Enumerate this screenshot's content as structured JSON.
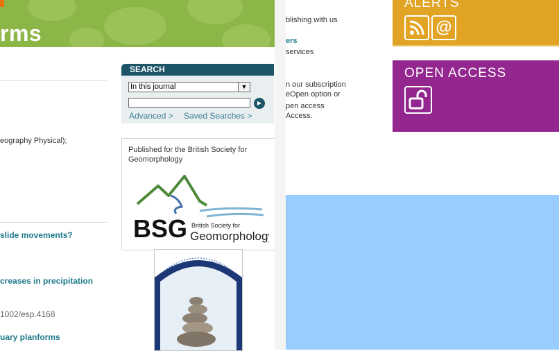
{
  "banner": {
    "title": "rms"
  },
  "left": {
    "subject_text": "eography Physical);",
    "article1_title": "slide movements?",
    "article2_title": "creases in precipitation",
    "doi": "1002/esp.4168",
    "article3_title": "uary planforms"
  },
  "search": {
    "heading": "SEARCH",
    "scope_value": "In this journal",
    "advanced_link": "Advanced >",
    "saved_link": "Saved Searches >"
  },
  "society": {
    "text": "Published for the British Society for Geomorphology",
    "logo_acronym": "BSG",
    "logo_line1": "British Society for",
    "logo_line2": "Geomorphology"
  },
  "middle": {
    "publishing_text": "blishing with us",
    "services_heading": "ers",
    "services_text": "services",
    "subscription_lines": [
      "n our subscription",
      "eOpen option or",
      "pen access",
      "Access."
    ]
  },
  "alerts": {
    "label": "ALERTS"
  },
  "open_access": {
    "label": "OPEN ACCESS"
  },
  "colors": {
    "banner_green": "#8cb648",
    "search_header": "#1b5567",
    "alerts_orange": "#e1a424",
    "open_access_purple": "#93278f",
    "link_teal": "#1f7a8c",
    "ad_blue": "#99ccff"
  },
  "icons": [
    "rss-icon",
    "email-alert-icon",
    "open-lock-icon",
    "search-go-icon",
    "dropdown-arrow-icon"
  ]
}
